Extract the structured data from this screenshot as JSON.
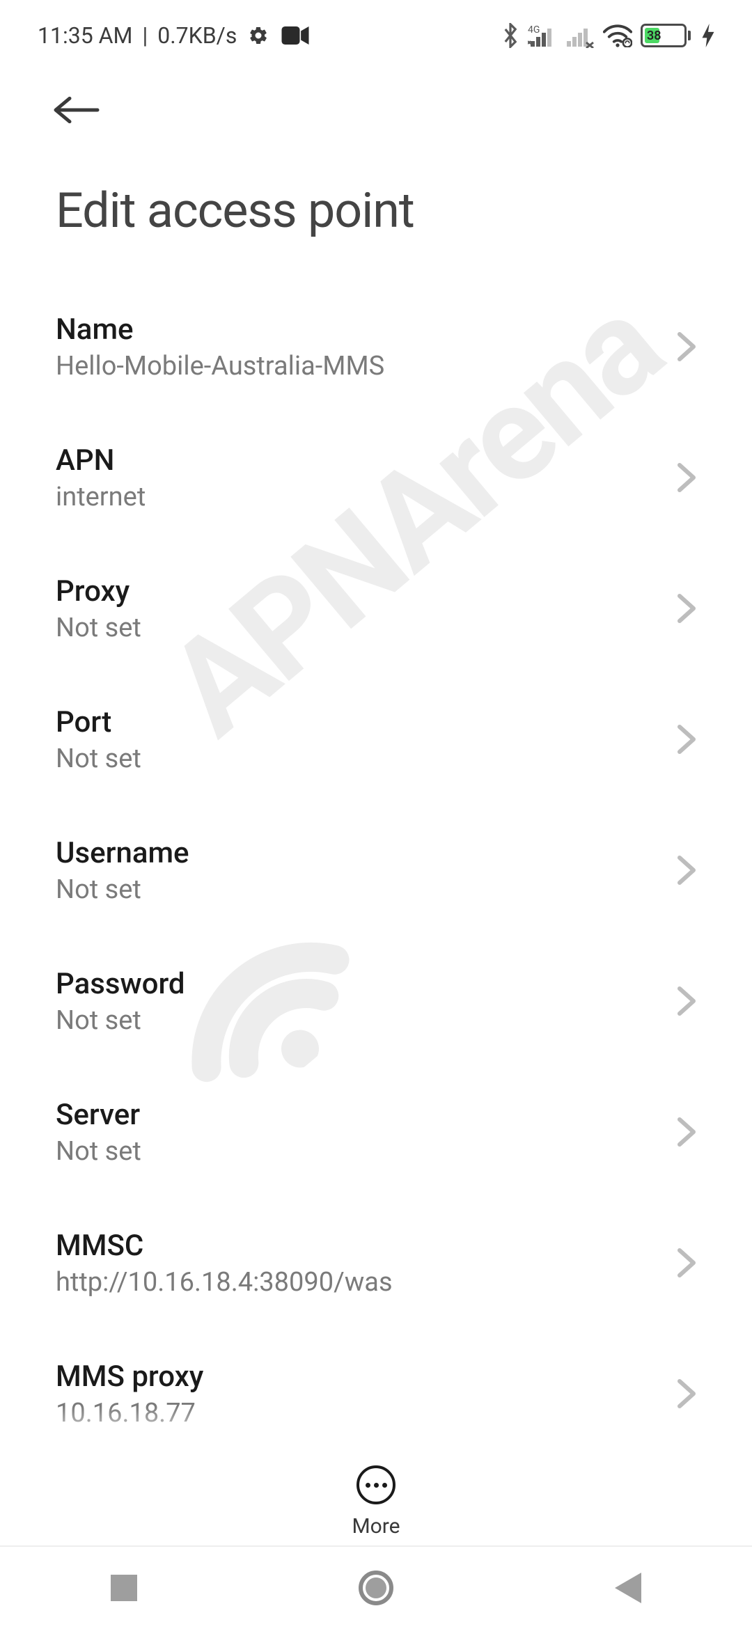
{
  "status": {
    "time": "11:35 AM",
    "speed": "0.7KB/s",
    "network_badge": "4G",
    "battery_pct": "38"
  },
  "page": {
    "title": "Edit access point"
  },
  "rows": [
    {
      "label": "Name",
      "value": "Hello-Mobile-Australia-MMS"
    },
    {
      "label": "APN",
      "value": "internet"
    },
    {
      "label": "Proxy",
      "value": "Not set"
    },
    {
      "label": "Port",
      "value": "Not set"
    },
    {
      "label": "Username",
      "value": "Not set"
    },
    {
      "label": "Password",
      "value": "Not set"
    },
    {
      "label": "Server",
      "value": "Not set"
    },
    {
      "label": "MMSC",
      "value": "http://10.16.18.4:38090/was"
    },
    {
      "label": "MMS proxy",
      "value": "10.16.18.77"
    }
  ],
  "more": {
    "label": "More"
  },
  "watermark": {
    "text": "APNArena"
  }
}
